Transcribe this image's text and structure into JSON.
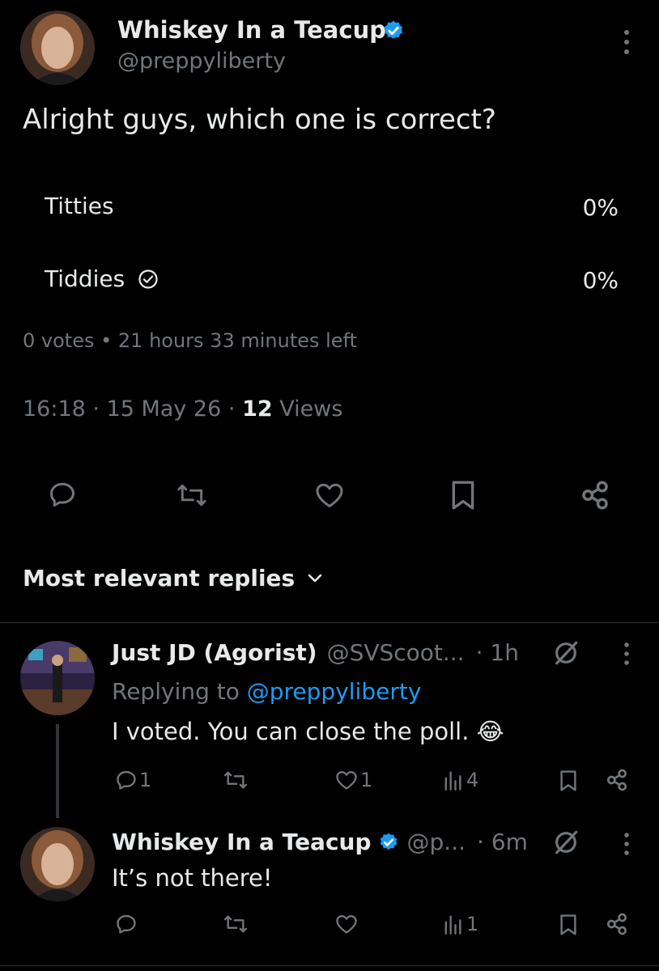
{
  "tweet": {
    "author_name": "Whiskey In a Teacup",
    "author_handle": "@preppyliberty",
    "text": "Alright guys, which one is correct?",
    "poll": {
      "options": [
        {
          "label": "Titties",
          "percent": "0%",
          "selected": false
        },
        {
          "label": "Tiddies",
          "percent": "0%",
          "selected": true
        }
      ],
      "votes": "0 votes",
      "separator": "•",
      "time_left": "21 hours 33 minutes left"
    },
    "time": "16:18",
    "date": "15 May 26",
    "dot": "·",
    "views_count": "12",
    "views_label": "Views"
  },
  "replies_sort": {
    "label": "Most relevant replies"
  },
  "replies": [
    {
      "author_name": "Just JD (Agorist)",
      "author_handle": "@SVScoot...",
      "time": "· 1h",
      "replying_to_label": "Replying to",
      "replying_to_handle": "@preppyliberty",
      "text": "I voted. You can close the poll.",
      "emoji": "😂",
      "reply_count": "1",
      "like_count": "1",
      "view_count": "4"
    },
    {
      "author_name": "Whiskey In a Teacup",
      "author_handle": "@p...",
      "time": "· 6m",
      "text": "It’s not there!",
      "view_count": "1"
    }
  ],
  "colors": {
    "background": "#000000",
    "text": "#e7e9ea",
    "muted": "#71767b",
    "accent": "#1d9bf0",
    "divider": "#2f3336"
  },
  "icons": [
    "verified-badge-icon",
    "more-icon",
    "check-circle-icon",
    "reply-icon",
    "retweet-icon",
    "like-icon",
    "bookmark-icon",
    "share-icon",
    "chevron-down-icon",
    "grok-icon",
    "views-icon"
  ]
}
